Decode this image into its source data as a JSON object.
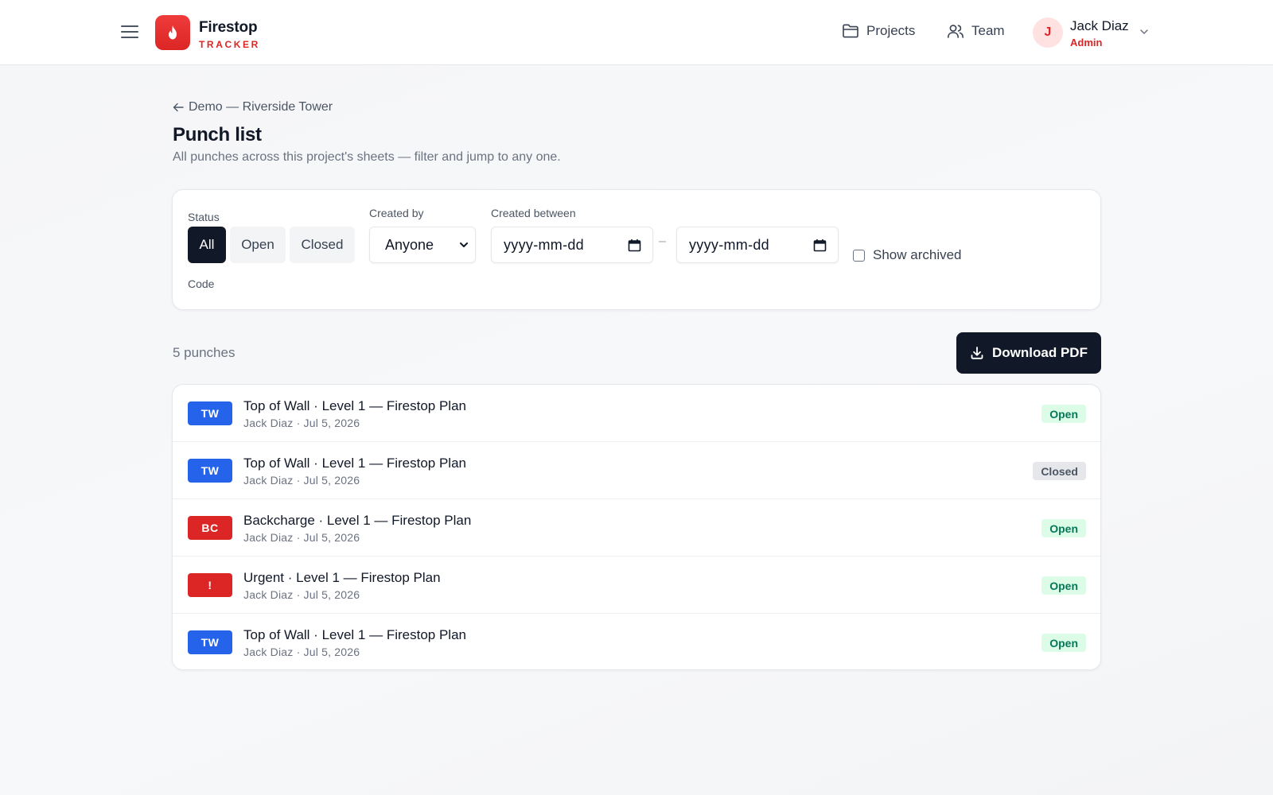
{
  "header": {
    "brand_name": "Firestop",
    "brand_sub": "TRACKER",
    "nav": [
      {
        "label": "Projects",
        "icon": "folder-icon"
      },
      {
        "label": "Team",
        "icon": "users-icon"
      }
    ],
    "user": {
      "initial": "J",
      "name": "Jack Diaz",
      "role": "Admin"
    }
  },
  "page": {
    "breadcrumb": "Demo — Riverside Tower",
    "title": "Punch list",
    "subtitle": "All punches across this project's sheets — filter and jump to any one."
  },
  "filters": {
    "status_label": "Status",
    "status_options": [
      "All",
      "Open",
      "Closed"
    ],
    "status_selected": "All",
    "created_by_label": "Created by",
    "created_by_value": "Anyone",
    "created_between_label": "Created between",
    "date_from_placeholder": "yyyy-mm-dd",
    "date_to_placeholder": "yyyy-mm-dd",
    "date_separator": "–",
    "show_archived_label": "Show archived",
    "show_archived_checked": false,
    "code_label": "Code"
  },
  "list": {
    "count_text": "5 punches",
    "download_label": "Download PDF",
    "items": [
      {
        "code": "TW",
        "code_color": "#2563eb",
        "title": "Top of Wall · Level 1 — Firestop Plan",
        "meta": "Jack Diaz · Jul 5, 2026",
        "status": "Open"
      },
      {
        "code": "TW",
        "code_color": "#2563eb",
        "title": "Top of Wall · Level 1 — Firestop Plan",
        "meta": "Jack Diaz · Jul 5, 2026",
        "status": "Closed"
      },
      {
        "code": "BC",
        "code_color": "#dc2626",
        "title": "Backcharge · Level 1 — Firestop Plan",
        "meta": "Jack Diaz · Jul 5, 2026",
        "status": "Open"
      },
      {
        "code": "!",
        "code_color": "#dc2626",
        "title": "Urgent · Level 1 — Firestop Plan",
        "meta": "Jack Diaz · Jul 5, 2026",
        "status": "Open"
      },
      {
        "code": "TW",
        "code_color": "#2563eb",
        "title": "Top of Wall · Level 1 — Firestop Plan",
        "meta": "Jack Diaz · Jul 5, 2026",
        "status": "Open"
      }
    ]
  },
  "colors": {
    "brand": "#dc2626",
    "dark": "#111827",
    "open_bg": "#dcfce7",
    "open_text": "#047857",
    "closed_bg": "#e5e7eb",
    "closed_text": "#4b5563"
  }
}
